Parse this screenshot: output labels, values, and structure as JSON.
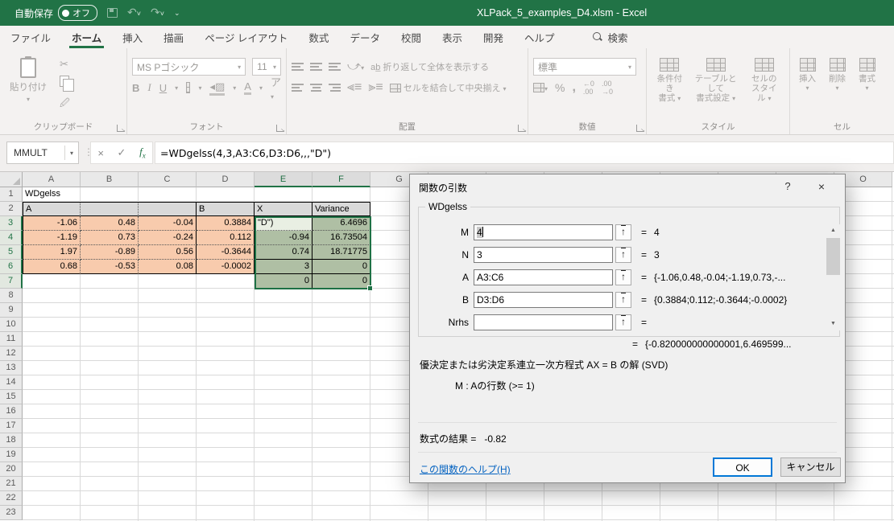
{
  "titlebar": {
    "autosave_label": "自動保存",
    "autosave_state": "オフ",
    "title": "XLPack_5_examples_D4.xlsm  -  Excel"
  },
  "tabs": [
    {
      "label": "ファイル",
      "active": false
    },
    {
      "label": "ホーム",
      "active": true
    },
    {
      "label": "挿入",
      "active": false
    },
    {
      "label": "描画",
      "active": false
    },
    {
      "label": "ページ レイアウト",
      "active": false
    },
    {
      "label": "数式",
      "active": false
    },
    {
      "label": "データ",
      "active": false
    },
    {
      "label": "校閲",
      "active": false
    },
    {
      "label": "表示",
      "active": false
    },
    {
      "label": "開発",
      "active": false
    },
    {
      "label": "ヘルプ",
      "active": false
    }
  ],
  "search": {
    "label": "検索"
  },
  "ribbon": {
    "paste": "貼り付け",
    "font_name": "MS Pゴシック",
    "font_size": "11",
    "grow_font": "A^",
    "shrink_font": "A˅",
    "bold": "B",
    "italic": "I",
    "underline": "U",
    "wrap_text": "折り返して全体を表示する",
    "merge_center": "セルを結合して中央揃え",
    "number_format": "標準",
    "percent": "%",
    "comma": ",",
    "style_buttons": [
      {
        "line1": "条件付き",
        "line2": "書式"
      },
      {
        "line1": "テーブルとして",
        "line2": "書式設定"
      },
      {
        "line1": "セルの",
        "line2": "スタイル"
      }
    ],
    "cell_buttons": [
      "挿入",
      "削除",
      "書式"
    ],
    "group_labels": {
      "clipboard": "クリップボード",
      "font": "フォント",
      "alignment": "配置",
      "number": "数値",
      "styles": "スタイル",
      "cells": "セル"
    }
  },
  "formula_bar": {
    "name_box": "MMULT",
    "formula": "=WDgelss(4,3,A3:C6,D3:D6,,,\"D\")"
  },
  "grid": {
    "columns": [
      "A",
      "B",
      "C",
      "D",
      "E",
      "F",
      "G",
      "H",
      "I",
      "J",
      "K",
      "L",
      "M",
      "N",
      "O"
    ],
    "selected_columns": [
      "E",
      "F"
    ],
    "row_count": 23,
    "selected_rows": [
      3,
      4,
      5,
      6,
      7
    ],
    "cells": [
      {
        "ref": "A1",
        "text": "WDgelss",
        "cls": "txt"
      },
      {
        "ref": "A2",
        "text": "A",
        "cls": "txt hdr bt bb bl dbr"
      },
      {
        "ref": "B2",
        "text": "",
        "cls": "txt hdr bt bb dbr"
      },
      {
        "ref": "C2",
        "text": "",
        "cls": "txt hdr bt bb br"
      },
      {
        "ref": "D2",
        "text": "B",
        "cls": "txt hdr bt bb br"
      },
      {
        "ref": "E2",
        "text": "X",
        "cls": "txt hdr bt bb br"
      },
      {
        "ref": "F2",
        "text": "Variance",
        "cls": "txt hdr bt bb br"
      },
      {
        "ref": "A3",
        "text": "-1.06",
        "cls": "num orange bl dbr dbb"
      },
      {
        "ref": "B3",
        "text": "0.48",
        "cls": "num orange dbr dbb"
      },
      {
        "ref": "C3",
        "text": "-0.04",
        "cls": "num orange br dbb"
      },
      {
        "ref": "D3",
        "text": "0.3884",
        "cls": "num orange br dbb"
      },
      {
        "ref": "E3",
        "text": "\"D\")",
        "cls": "txt gactive bl br dbb"
      },
      {
        "ref": "F3",
        "text": "6.4696",
        "cls": "num gsel br dbb"
      },
      {
        "ref": "A4",
        "text": "-1.19",
        "cls": "num orange bl dbr dbb"
      },
      {
        "ref": "B4",
        "text": "0.73",
        "cls": "num orange dbr dbb"
      },
      {
        "ref": "C4",
        "text": "-0.24",
        "cls": "num orange br dbb"
      },
      {
        "ref": "D4",
        "text": "0.112",
        "cls": "num orange br dbb"
      },
      {
        "ref": "E4",
        "text": "-0.94",
        "cls": "num gsel bl br dbb"
      },
      {
        "ref": "F4",
        "text": "16.73504",
        "cls": "num gsel br dbb"
      },
      {
        "ref": "A5",
        "text": "1.97",
        "cls": "num orange bl dbr dbb"
      },
      {
        "ref": "B5",
        "text": "-0.89",
        "cls": "num orange dbr dbb"
      },
      {
        "ref": "C5",
        "text": "0.56",
        "cls": "num orange br dbb"
      },
      {
        "ref": "D5",
        "text": "-0.3644",
        "cls": "num orange br dbb"
      },
      {
        "ref": "E5",
        "text": "0.74",
        "cls": "num gsel bl br bb"
      },
      {
        "ref": "F5",
        "text": "18.71775",
        "cls": "num gsel br bb"
      },
      {
        "ref": "A6",
        "text": "0.68",
        "cls": "num orange bl dbr bb"
      },
      {
        "ref": "B6",
        "text": "-0.53",
        "cls": "num orange dbr bb"
      },
      {
        "ref": "C6",
        "text": "0.08",
        "cls": "num orange br bb"
      },
      {
        "ref": "D6",
        "text": "-0.0002",
        "cls": "num orange br bb"
      },
      {
        "ref": "E6",
        "text": "3",
        "cls": "num gsel bl br bb"
      },
      {
        "ref": "F6",
        "text": "0",
        "cls": "num gsel br bb"
      },
      {
        "ref": "E7",
        "text": "0",
        "cls": "num gsel bl br bb"
      },
      {
        "ref": "F7",
        "text": "0",
        "cls": "num gsel br bb"
      }
    ]
  },
  "dialog": {
    "title": "関数の引数",
    "help_symbol": "?",
    "close_symbol": "×",
    "function_name": "WDgelss",
    "fields": [
      {
        "label": "M",
        "value": "4",
        "eq": "=",
        "preview": "4",
        "selected": true
      },
      {
        "label": "N",
        "value": "3",
        "eq": "=",
        "preview": "3",
        "selected": false
      },
      {
        "label": "A",
        "value": "A3:C6",
        "eq": "=",
        "preview": "{-1.06,0.48,-0.04;-1.19,0.73,-...",
        "selected": false
      },
      {
        "label": "B",
        "value": "D3:D6",
        "eq": "=",
        "preview": "{0.3884;0.112;-0.3644;-0.0002}",
        "selected": false
      },
      {
        "label": "Nrhs",
        "value": "",
        "eq": "=",
        "preview": "",
        "selected": false
      }
    ],
    "result_eq": "=",
    "result_preview": "{-0.820000000000001,6.469599...",
    "description": "優決定または劣決定系連立一次方程式 AX = B の解 (SVD)",
    "arg_help": "M  : Aの行数 (>= 1)",
    "formula_result_label": "数式の結果 =",
    "formula_result_value": "-0.82",
    "help_link": "この関数のヘルプ(H)",
    "ok_label": "OK",
    "cancel_label": "キャンセル"
  },
  "colors": {
    "excel_green": "#217346",
    "orange_fill": "#F8CBAD",
    "green_fill_selected": "#AFBFA4",
    "green_fill_active": "#E9EFE3",
    "header_fill": "#D9D9D9",
    "ok_border": "#0078D7",
    "link": "#0563C1"
  }
}
